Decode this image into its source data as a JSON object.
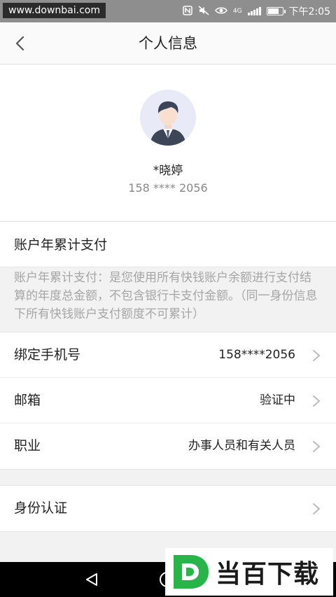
{
  "status_bar": {
    "watermark": "www.downbai.com",
    "network": "4G",
    "time": "下午2:05"
  },
  "nav": {
    "title": "个人信息"
  },
  "profile": {
    "name": "*晓婷",
    "phone": "158 **** 2056"
  },
  "annual": {
    "label": "账户年累计支付",
    "note": "账户年累计支付：是您使用所有快钱账户余额进行支付结算的年度总金额，不包含银行卡支付金额。（同一身份信息下所有快钱账户支付额度不可累计）"
  },
  "info_list": [
    {
      "label": "绑定手机号",
      "value": "158****2056"
    },
    {
      "label": "邮箱",
      "value": "验证中"
    },
    {
      "label": "职业",
      "value": "办事人员和有关人员"
    }
  ],
  "identity": {
    "label": "身份认证"
  },
  "logo": {
    "letter": "D",
    "text": "当百下载"
  },
  "colors": {
    "logo_green": "#29b44a",
    "accent_gray": "#888888"
  }
}
